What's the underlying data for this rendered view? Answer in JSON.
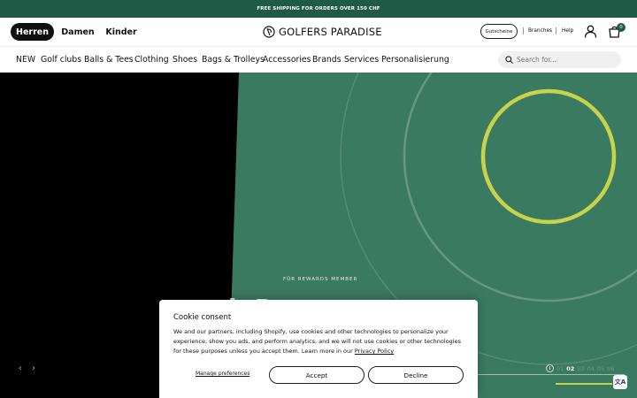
{
  "topbar": {
    "text": "FREE SHIPPING FOR ORDERS OVER 150 CHF"
  },
  "header": {
    "genders": [
      "Herren",
      "Damen",
      "Kinder"
    ],
    "logo_text": "GOLFERS PARADISE",
    "voucher_label": "Gutscheine",
    "branches_label": "Branches",
    "help_label": "Help",
    "cart_count": "0"
  },
  "nav": {
    "items": [
      "NEW",
      "Golf clubs",
      "Balls & Tees",
      "Clothing",
      "Shoes",
      "Bags & Trolleys",
      "Accessories",
      "Brands",
      "Services",
      "Personalisierung"
    ],
    "search_placeholder": "Search for..."
  },
  "hero": {
    "eyebrow": "FÜR REWARDS MEMBER",
    "headline": "h                R",
    "slides": [
      "01",
      "02",
      "03",
      "04",
      "05",
      "06"
    ],
    "active_slide": "02",
    "accent_color": "#c8d24a",
    "bg_color": "#3a7a60"
  },
  "cookie": {
    "title": "Cookie consent",
    "text": "We and our partners, including Shopify, use cookies and other technologies to personalize your experience, show you ads, and perform analytics, and we will not use cookies or other technologies for these purposes unless you accept them. Learn more in our",
    "policy_link": "Privacy Policy",
    "manage_label": "Manage preferences",
    "accept_label": "Accept",
    "decline_label": "Decline"
  },
  "translate_icon_label": "文A"
}
